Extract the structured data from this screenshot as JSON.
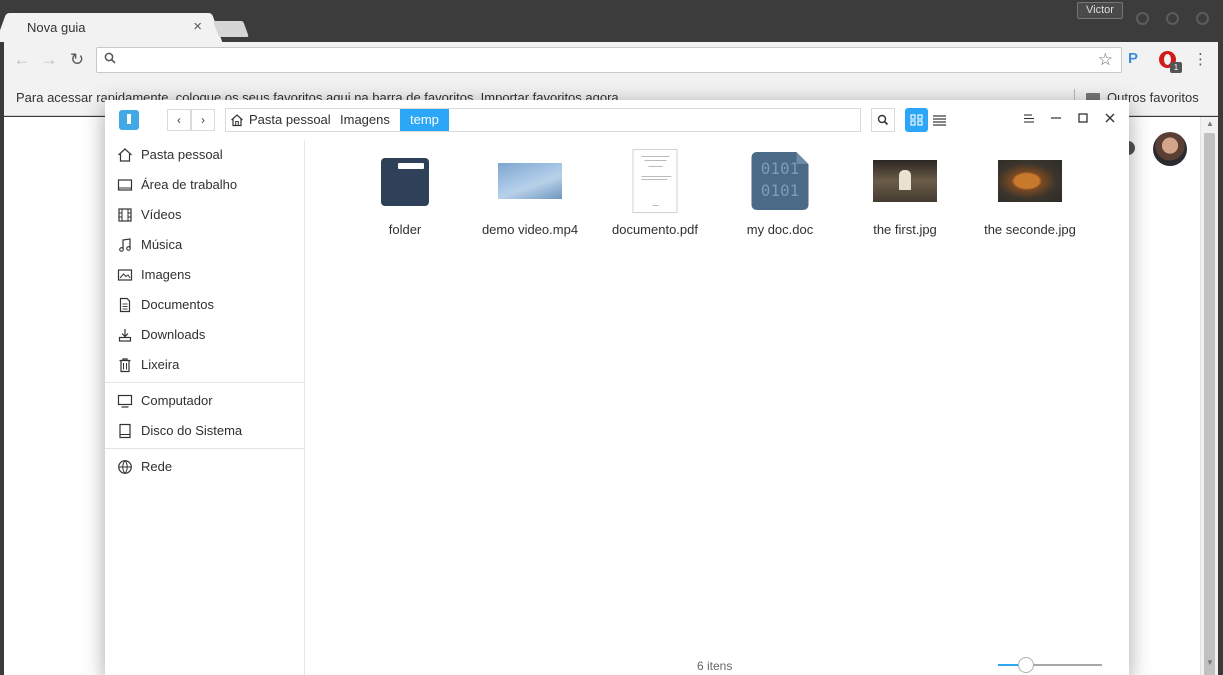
{
  "browser": {
    "tab_title": "Nova guia",
    "tab_close": "×",
    "profile_name": "Victor",
    "back_icon": "←",
    "forward_icon": "→",
    "reload_icon": "↻",
    "star_icon": "☆",
    "ext_p_label": "P",
    "ext_badge": "1",
    "menu_icon": "⋮",
    "bookmarks_hint": "Para acessar rapidamente, coloque os seus favoritos aqui na barra de favoritos. Importar favoritos agora...",
    "other_bookmarks": "Outros favoritos"
  },
  "file_manager": {
    "back_icon": "‹",
    "forward_icon": "›",
    "breadcrumb": [
      "Pasta pessoal",
      "Imagens",
      "temp"
    ],
    "sidebar": {
      "places": [
        "Pasta pessoal",
        "Área de trabalho",
        "Vídeos",
        "Música",
        "Imagens",
        "Documentos",
        "Downloads",
        "Lixeira"
      ],
      "devices": [
        "Computador",
        "Disco do Sistema"
      ],
      "network": [
        "Rede"
      ]
    },
    "files": [
      {
        "name": "folder",
        "icon": "folder-icon"
      },
      {
        "name": "demo video.mp4",
        "icon": "video-thumbnail"
      },
      {
        "name": "documento.pdf",
        "icon": "pdf-thumbnail"
      },
      {
        "name": "my doc.doc",
        "icon": "binary-file-icon",
        "glyph_line1": "0101",
        "glyph_line2": "0101"
      },
      {
        "name": "the first.jpg",
        "icon": "image-thumbnail"
      },
      {
        "name": "the seconde.jpg",
        "icon": "image-thumbnail"
      }
    ],
    "status_text": "6 itens",
    "zoom_level": 0.27,
    "view_mode": "icon-grid",
    "accent_color": "#2ca7f8"
  }
}
